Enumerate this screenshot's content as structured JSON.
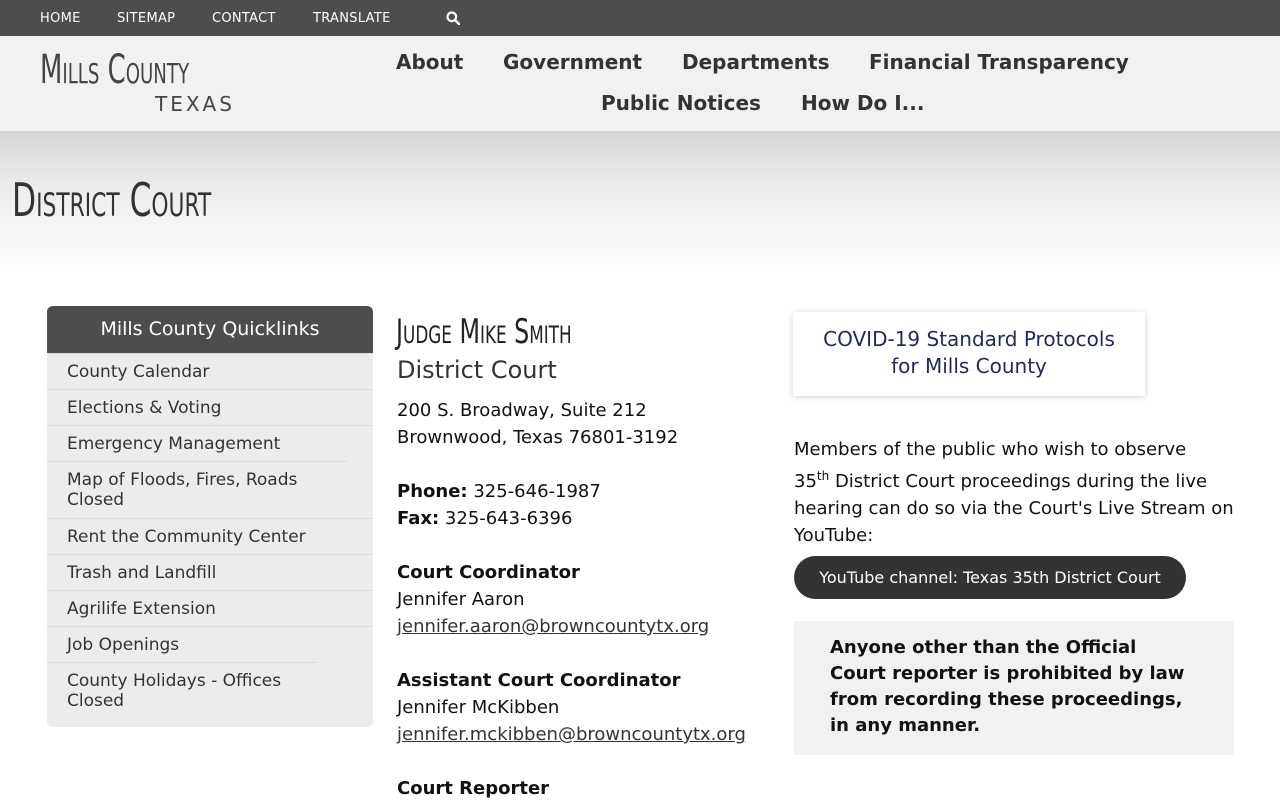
{
  "utility": {
    "home": "HOME",
    "sitemap": "SITEMAP",
    "contact": "CONTACT",
    "translate": "TRANSLATE",
    "search_icon": "search-icon"
  },
  "logo": {
    "main": "Mills County",
    "sub": "TEXAS"
  },
  "nav": {
    "about": "About",
    "government": "Government",
    "departments": "Departments",
    "financial": "Financial Transparency",
    "notices": "Public Notices",
    "howdoi": "How Do I..."
  },
  "page": {
    "title": "District Court"
  },
  "quicklinks": {
    "heading": "Mills County Quicklinks",
    "items": [
      "County Calendar",
      "Elections & Voting",
      "Emergency Management",
      "Map of Floods, Fires, Roads Closed",
      "Rent the Community Center",
      "Trash and Landfill",
      "Agrilife Extension",
      "Job Openings",
      "County Holidays - Offices Closed"
    ]
  },
  "main": {
    "judge": "Judge Mike Smith",
    "court": "District Court",
    "address1": "200 S. Broadway, Suite 212",
    "address2": "Brownwood, Texas 76801-3192",
    "phone_label": "Phone:",
    "phone": " 325-646-1987",
    "fax_label": "Fax:",
    "fax": " 325-643-6396",
    "coordinator_title": "Court Coordinator",
    "coordinator_name": "Jennifer Aaron",
    "coordinator_email": "jennifer.aaron@browncountytx.org",
    "assistant_title": "Assistant Court Coordinator",
    "assistant_name": "Jennifer McKibben",
    "assistant_email": "jennifer.mckibben@browncountytx.org",
    "reporter_title": "Court Reporter"
  },
  "aside": {
    "covid_line1": "COVID-19 Standard Protocols",
    "covid_line2": "for Mills County",
    "members_a": "Members of the public who wish to observe",
    "members_num": "35",
    "members_sup": "th",
    "members_b": " District Court proceedings during the live",
    "members_c": "hearing can do so via the Court's Live Stream on",
    "members_d": "YouTube:",
    "youtube_button": "YouTube channel: Texas 35th District Court",
    "notice_1": "Anyone other than the Official",
    "notice_2": "Court reporter is prohibited by law",
    "notice_3": "from recording these proceedings,",
    "notice_4": "in any manner."
  }
}
